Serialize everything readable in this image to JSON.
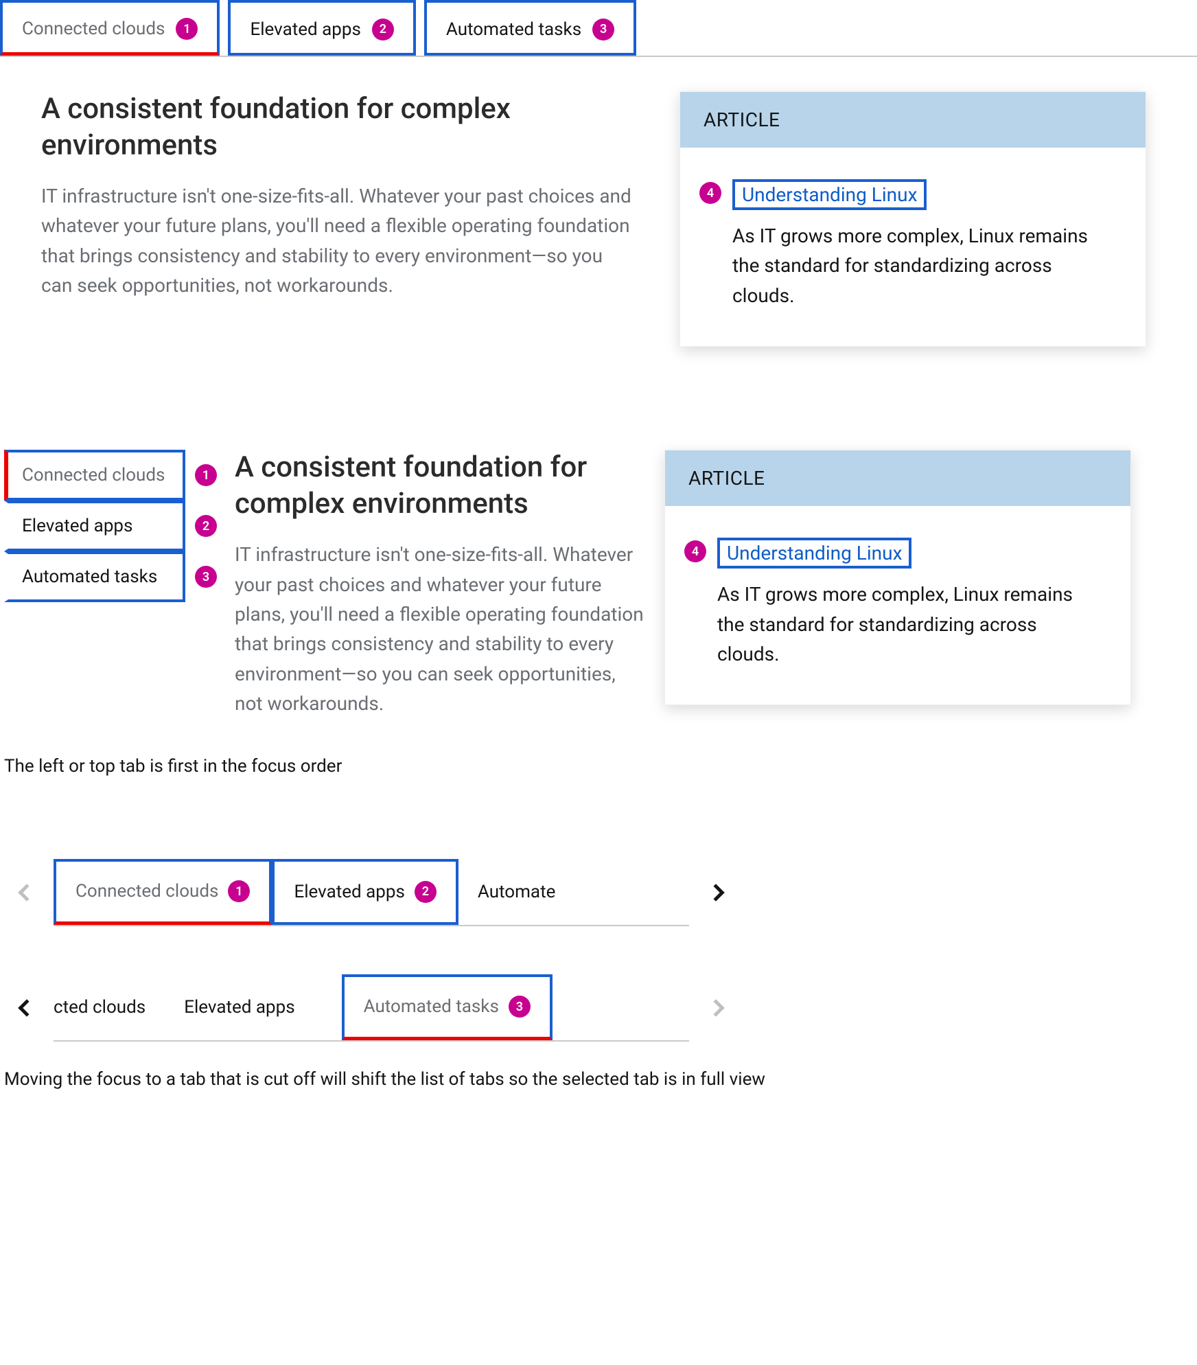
{
  "tabs": [
    "Connected clouds",
    "Elevated apps",
    "Automated tasks"
  ],
  "markers": [
    "1",
    "2",
    "3",
    "4"
  ],
  "heading": "A consistent foundation for complex environments",
  "body": "IT infrastructure isn't one-size-fits-all. Whatever your past choices and whatever your future plans, you'll need a flexible operating foundation that brings consistency and stability to every environment—so you can seek opportunities, not workarounds.",
  "card": {
    "label": "ARTICLE",
    "link": "Understanding Linux",
    "desc": "As IT grows more complex, Linux remains the standard for standardizing across clouds."
  },
  "caption1": "The left or top tab is first in the focus order",
  "caption2": "Moving the focus to a tab that is cut off will shift the list of tabs so the selected tab is in full view",
  "overflow": {
    "row1_partial": "Automate",
    "row2_partial": "cted clouds"
  }
}
